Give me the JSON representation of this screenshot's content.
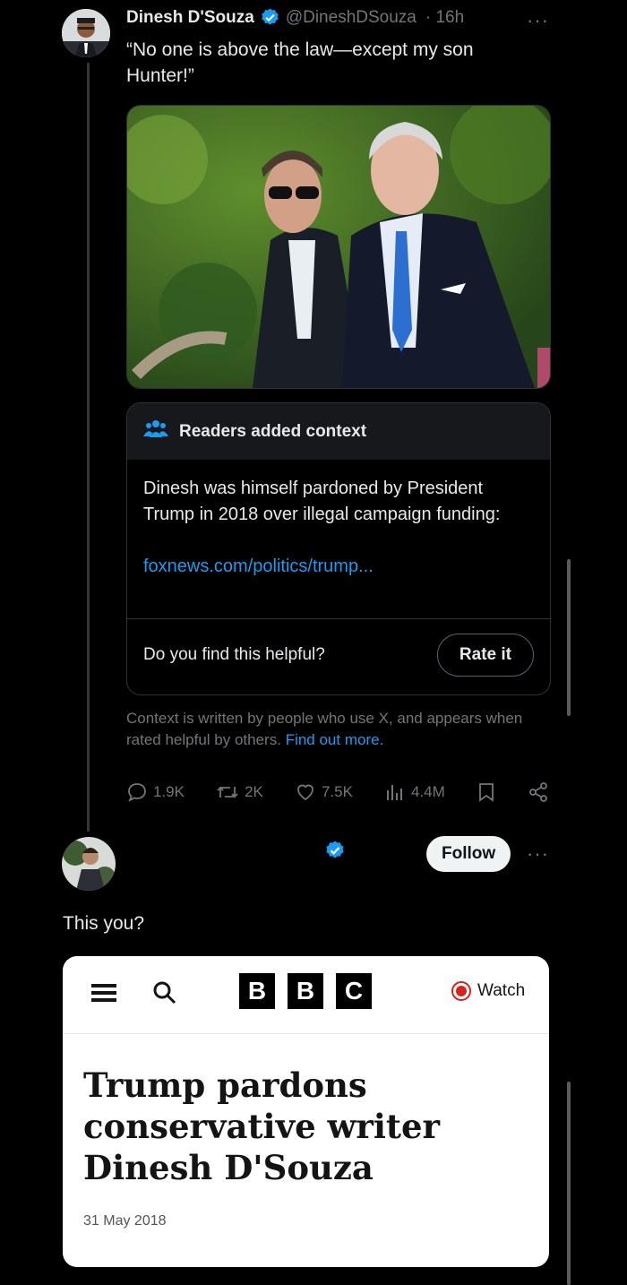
{
  "tweet": {
    "author_name": "Dinesh D'Souza",
    "handle": "@DineshDSouza",
    "time": "· 16h",
    "more_label": "···",
    "text": "“No one is above the law—except my son Hunter!”",
    "media_alt": "photo of Hunter Biden and Joe Biden walking outdoors"
  },
  "community_note": {
    "header": "Readers added context",
    "body": "Dinesh was himself pardoned by President Trump in 2018 over illegal campaign funding:",
    "link": "foxnews.com/politics/trump...",
    "question": "Do you find this helpful?",
    "rate_button": "Rate it",
    "info_text": "Context is written by people who use X, and appears when rated helpful by others.",
    "info_link": "Find out more."
  },
  "actions": {
    "replies": "1.9K",
    "reposts": "2K",
    "likes": "7.5K",
    "views": "4.4M"
  },
  "reply": {
    "follow_label": "Follow",
    "more_label": "···",
    "text": "This you?"
  },
  "bbc": {
    "logo_letters": [
      "B",
      "B",
      "C"
    ],
    "watch_label": "Watch",
    "headline": "Trump pardons conservative writer Dinesh D'Souza",
    "date": "31 May 2018"
  },
  "colors": {
    "accent": "#1d9bf0",
    "background": "#000000",
    "bbc_live": "#d6231e"
  }
}
